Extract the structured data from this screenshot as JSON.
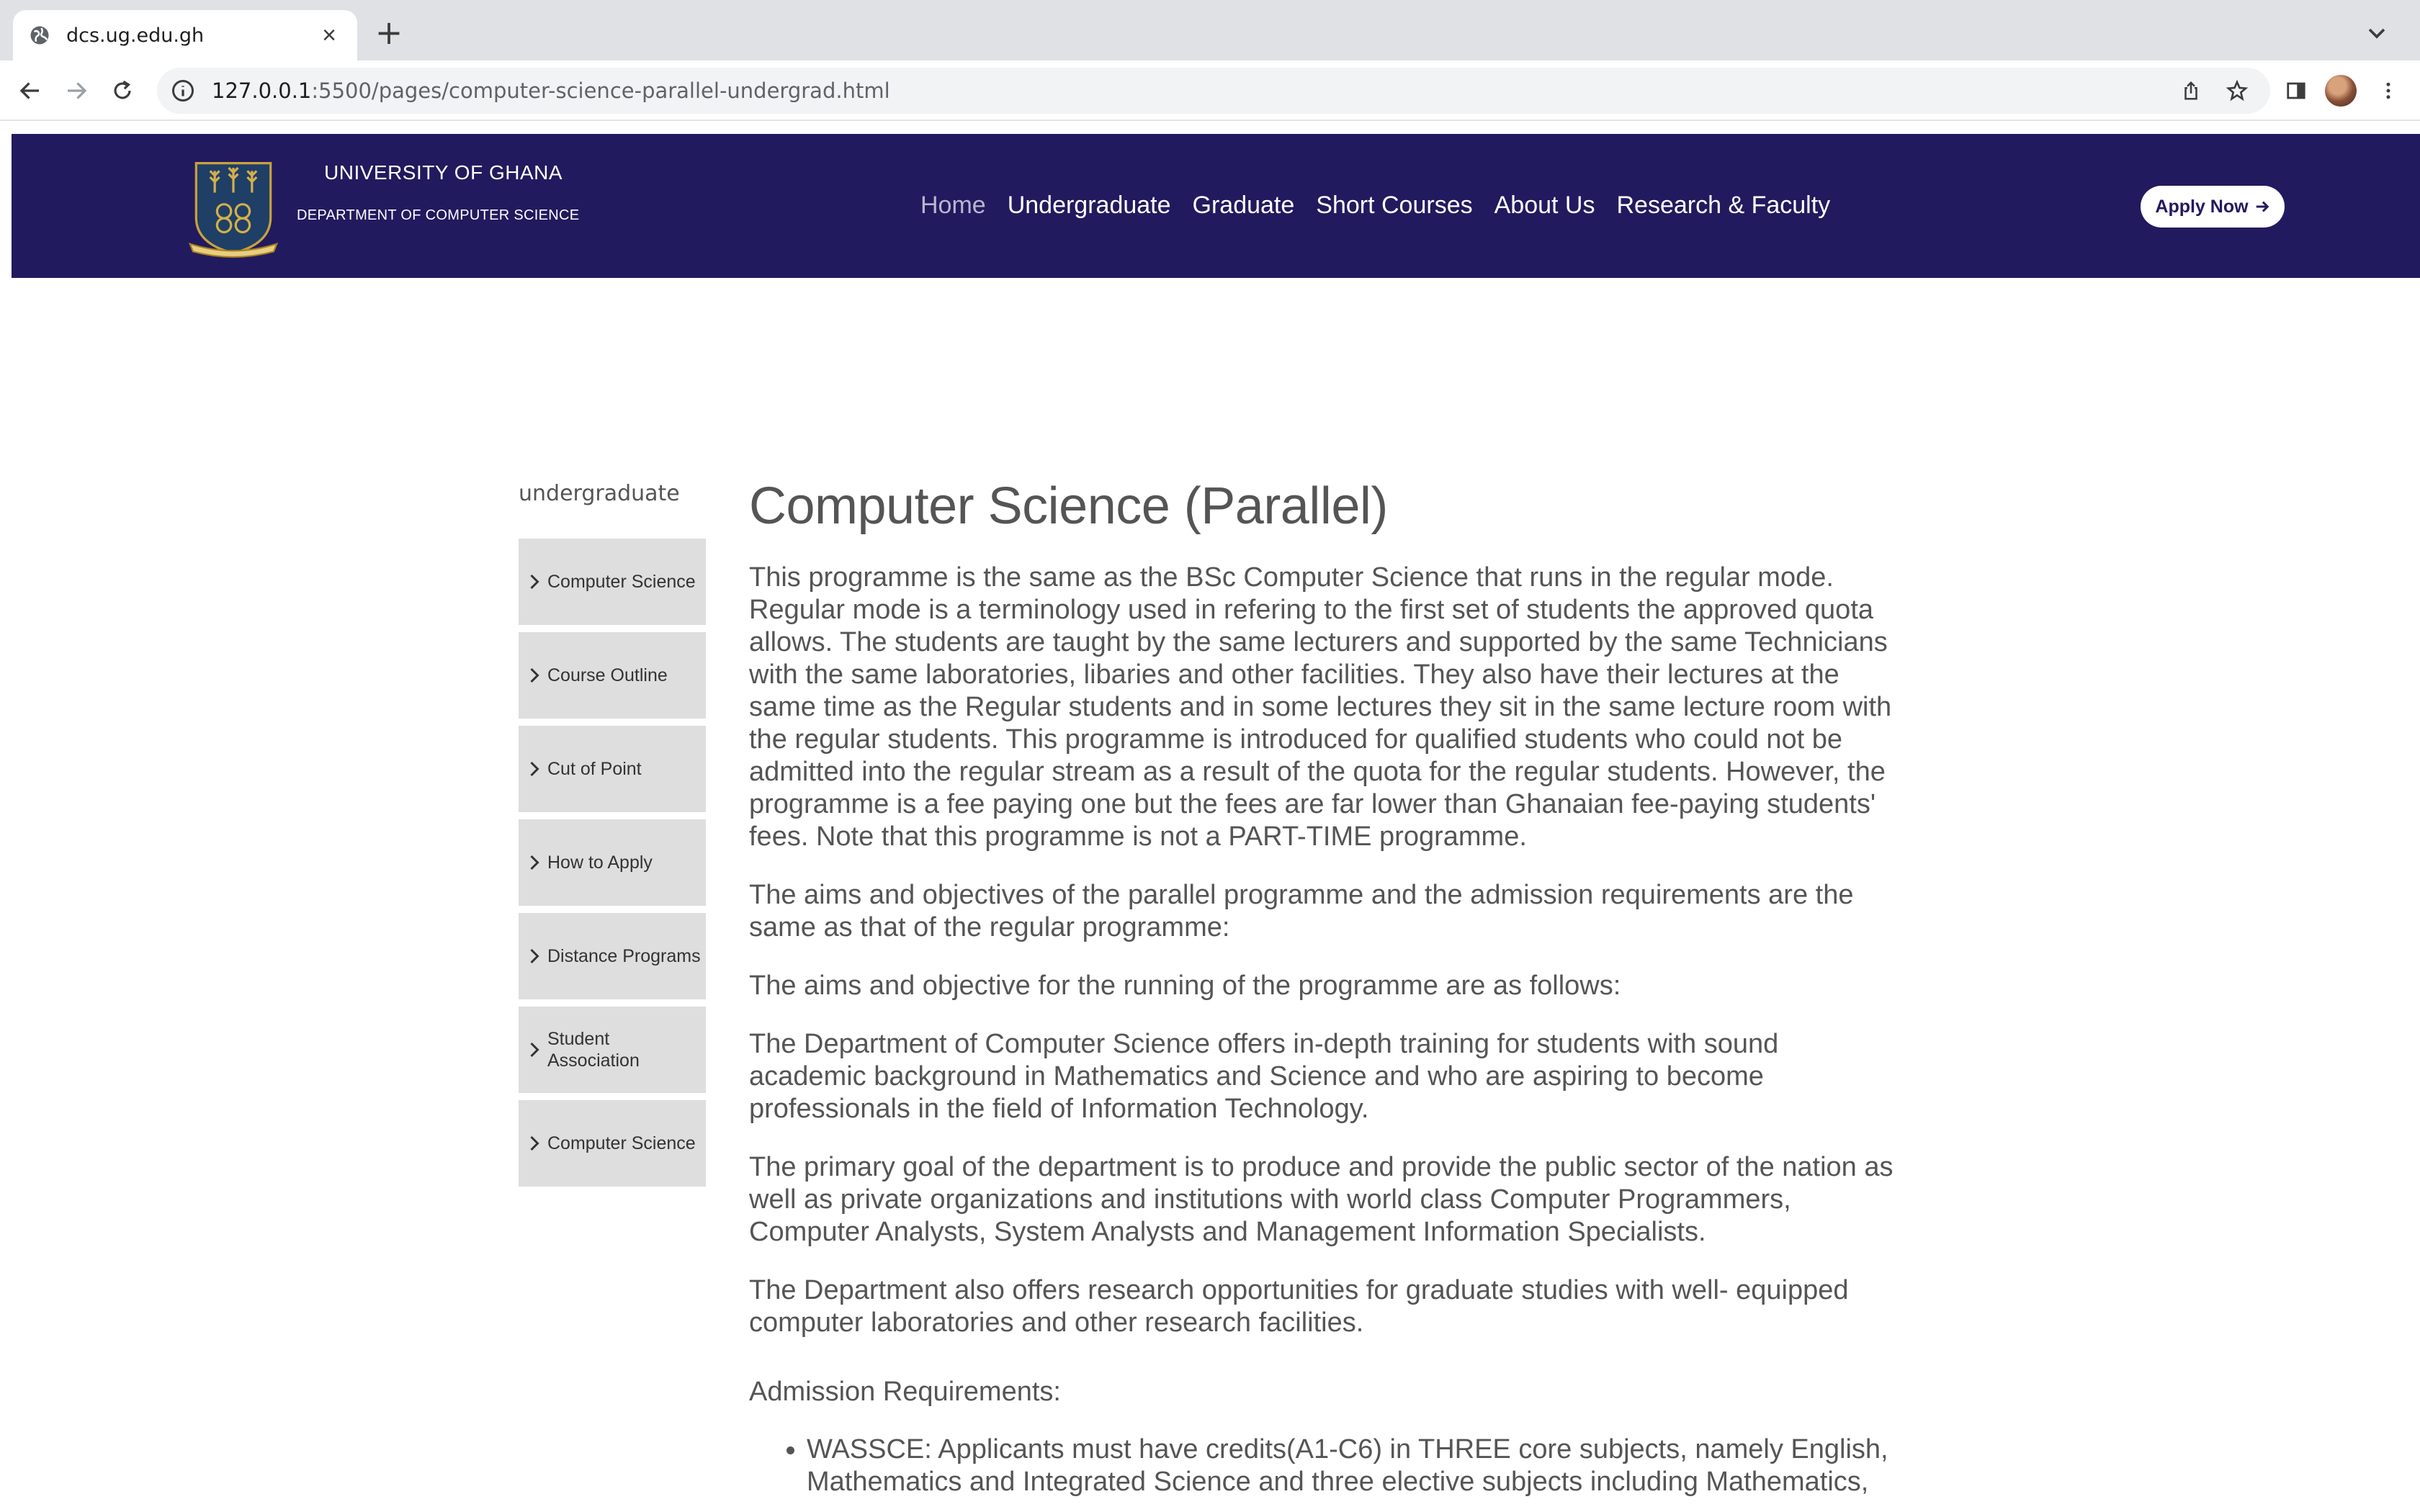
{
  "browser": {
    "tab_title": "dcs.ug.edu.gh",
    "url_host": "127.0.0.1",
    "url_path": ":5500/pages/computer-science-parallel-undergrad.html"
  },
  "header": {
    "university": "UNIVERSITY OF GHANA",
    "department": "DEPARTMENT OF COMPUTER SCIENCE",
    "nav": [
      "Home",
      "Undergraduate",
      "Graduate",
      "Short Courses",
      "About Us",
      "Research & Faculty"
    ],
    "apply_label": "Apply Now",
    "colors": {
      "header_bg": "#221a5e",
      "active_nav": "#b9b6cf"
    }
  },
  "sidebar": {
    "heading": "undergraduate",
    "items": [
      "Computer Science",
      "Course Outline",
      "Cut of Point",
      "How to Apply",
      "Distance Programs",
      "Student Association",
      "Computer Science"
    ]
  },
  "main": {
    "title": "Computer Science (Parallel)",
    "paragraphs": [
      "This programme is the same as the BSc Computer Science that runs in the regular mode. Regular mode is a terminology used in refering to the first set of students the approved quota allows. The students are taught by the same lecturers and supported by the same Technicians with the same laboratories, libaries and other facilities. They also have their lectures at the same time as the Regular students and in some lectures they sit in the same lecture room with the regular students. This programme is introduced for qualified students who could not be admitted into the regular stream as a result of the quota for the regular students. However, the programme is a fee paying one but the fees are far lower than Ghanaian fee-paying students' fees. Note that this programme is not a PART-TIME programme.",
      "The aims and objectives of the parallel programme and the admission requirements are the same as that of the regular programme:",
      "The aims and objective for the running of the programme are as follows:",
      "The Department of Computer Science offers in-depth training for students with sound academic background in Mathematics and Science and who are aspiring to become professionals in the field of Information Technology.",
      "The primary goal of the department is to produce and provide the public sector of the nation as well as private organizations and institutions with world class Computer Programmers, Computer Analysts, System Analysts and Management Information Specialists.",
      "The Department also offers research opportunities for graduate studies with well- equipped computer laboratories and other research facilities."
    ],
    "admission_heading": "Admission Requirements:",
    "requirements": [
      "WASSCE: Applicants must have credits(A1-C6) in THREE core subjects, namely English, Mathematics and Integrated Science and three elective subjects including Mathematics,"
    ]
  }
}
